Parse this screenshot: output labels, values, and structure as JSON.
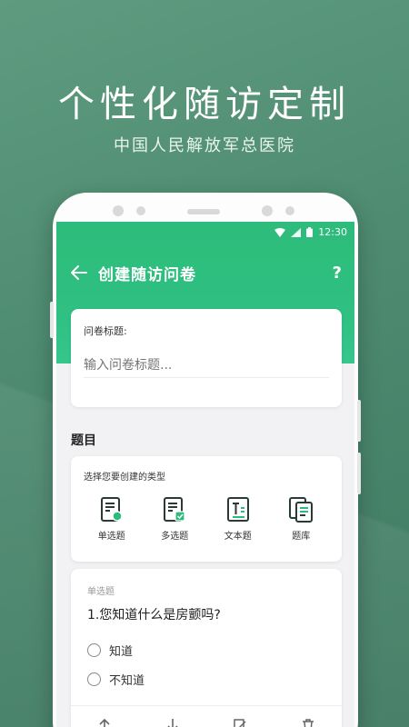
{
  "hero": {
    "title": "个性化随访定制",
    "subtitle": "中国人民解放军总医院"
  },
  "status_bar": {
    "time": "12:30",
    "icons": [
      "wifi-icon",
      "cellular-signal-icon",
      "battery-icon"
    ]
  },
  "header": {
    "title": "创建随访问卷",
    "back_icon": "arrow-left-icon",
    "help_label": "?"
  },
  "survey_title": {
    "label": "问卷标题:",
    "placeholder": "输入问卷标题..."
  },
  "section": {
    "label": "题目"
  },
  "question_types": {
    "prompt": "选择您要创建的类型",
    "items": [
      {
        "label": "单选题",
        "icon": "single-choice-icon"
      },
      {
        "label": "多选题",
        "icon": "multiple-choice-icon"
      },
      {
        "label": "文本题",
        "icon": "text-question-icon"
      },
      {
        "label": "题库",
        "icon": "question-bank-icon"
      }
    ]
  },
  "question": {
    "type_label": "单选题",
    "text": "1.您知道什么是房颤吗?",
    "options": [
      "知道",
      "不知道"
    ],
    "actions": [
      "move-up-icon",
      "move-down-icon",
      "edit-icon",
      "delete-icon"
    ]
  },
  "colors": {
    "brand_green": "#2ebc7c",
    "background_green": "#4d8a70",
    "icon_dark": "#2a3a35"
  }
}
